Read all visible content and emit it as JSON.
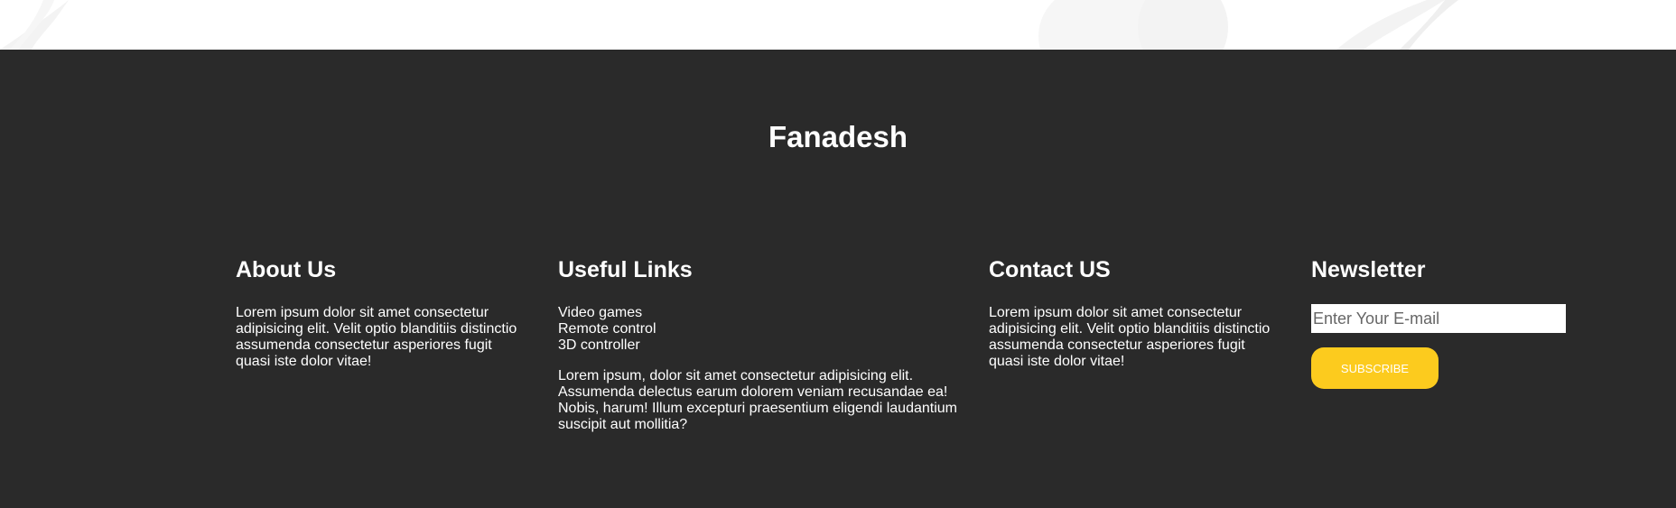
{
  "brand": {
    "name": "Fanadesh"
  },
  "about": {
    "heading": "About Us",
    "text": "Lorem ipsum dolor sit amet consectetur adipisicing elit. Velit optio blanditiis distinctio assumenda consectetur asperiores fugit quasi iste dolor vitae!"
  },
  "links": {
    "heading": "Useful Links",
    "items": [
      "Video games",
      "Remote control",
      "3D controller"
    ],
    "text": "Lorem ipsum, dolor sit amet consectetur adipisicing elit. Assumenda delectus earum dolorem veniam recusandae ea! Nobis, harum! Illum excepturi praesentium eligendi laudantium suscipit aut mollitia?"
  },
  "contact": {
    "heading": "Contact US",
    "text": "Lorem ipsum dolor sit amet consectetur adipisicing elit. Velit optio blanditiis distinctio assumenda consectetur asperiores fugit quasi iste dolor vitae!"
  },
  "newsletter": {
    "heading": "Newsletter",
    "email_placeholder": "Enter Your E-mail",
    "email_value": "",
    "subscribe_label": "SUBSCRIBE"
  },
  "colors": {
    "footer_bg": "#2a2a2a",
    "accent": "#fccb1e",
    "text": "#ffffff"
  }
}
